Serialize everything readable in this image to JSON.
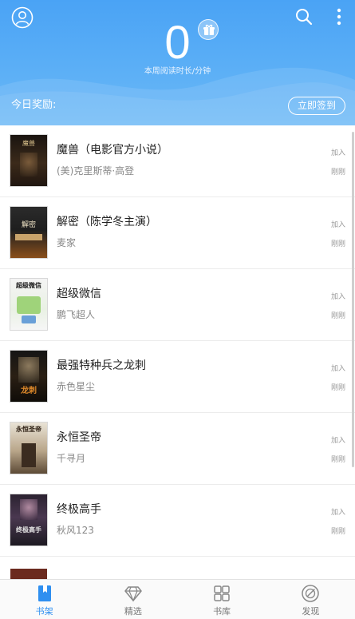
{
  "header": {
    "weekly_minutes": "0",
    "stat_label": "本周阅读时长/分钟",
    "reward_label": "今日奖励:",
    "signin_label": "立即签到"
  },
  "books": [
    {
      "title": "魔兽（电影官方小说）",
      "author": "(美)克里斯蒂·高登",
      "status": "加入",
      "time": "刚刚",
      "cover_text": "魔兽"
    },
    {
      "title": "解密（陈学冬主演）",
      "author": "麦家",
      "status": "加入",
      "time": "刚刚",
      "cover_text": "解密"
    },
    {
      "title": "超级微信",
      "author": "鹏飞超人",
      "status": "加入",
      "time": "刚刚",
      "cover_text": "超级微信"
    },
    {
      "title": "最强特种兵之龙刺",
      "author": "赤色星尘",
      "status": "加入",
      "time": "刚刚",
      "cover_text": "龙刺"
    },
    {
      "title": "永恒圣帝",
      "author": "千寻月",
      "status": "加入",
      "time": "刚刚",
      "cover_text": "永恒圣帝"
    },
    {
      "title": "终极高手",
      "author": "秋风123",
      "status": "加入",
      "time": "刚刚",
      "cover_text": "终极高手"
    }
  ],
  "nav": [
    {
      "label": "书架",
      "icon": "bookshelf-icon",
      "active": true
    },
    {
      "label": "精选",
      "icon": "diamond-icon",
      "active": false
    },
    {
      "label": "书库",
      "icon": "grid-icon",
      "active": false
    },
    {
      "label": "发现",
      "icon": "compass-icon",
      "active": false
    }
  ],
  "colors": {
    "header_blue": "#4aa3f5",
    "active_nav": "#2f8ff0"
  }
}
